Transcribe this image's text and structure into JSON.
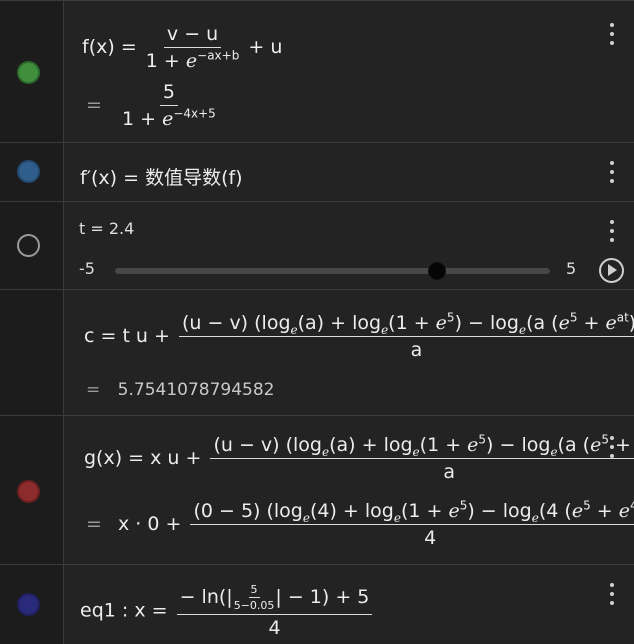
{
  "colors": {
    "f_dot": "#3f8f3f",
    "fp_dot": "#2f5d8c",
    "t_dot": "#9a9a9a",
    "g_dot": "#8c2b2b",
    "eq1_dot": "#2a2a7a"
  },
  "row_f": {
    "lhs": "f(x)",
    "eq": "=",
    "num": "v − u",
    "den_pre": "1 +",
    "e": "e",
    "den_exp": "−ax+b",
    "tail": "+ u",
    "res_eq": "=",
    "res_num": "5",
    "res_den_pre": "1 +",
    "res_exp": "−4x+5"
  },
  "row_fp": {
    "text": "f′(x) = 数值导数(f)"
  },
  "row_t": {
    "text": "t = 2.4",
    "min": "-5",
    "max": "5",
    "value": 2.4,
    "range_min": -5,
    "range_max": 5
  },
  "row_c": {
    "lhs": "c = t u +",
    "num": "(u − v) (log",
    "den": "a",
    "res_eq": "=",
    "result": "5.7541078794582"
  },
  "row_g": {
    "lhs": "g(x) = x u +",
    "den": "a",
    "res_eq": "=",
    "res_lhs": "x · 0 +",
    "res_den": "4"
  },
  "row_eq1": {
    "lhs": "eq1 : x =",
    "num_pre": "− ln(|",
    "inner_num": "5",
    "inner_den": "5−0.05",
    "num_post": "| − 1) + 5",
    "den": "4"
  }
}
